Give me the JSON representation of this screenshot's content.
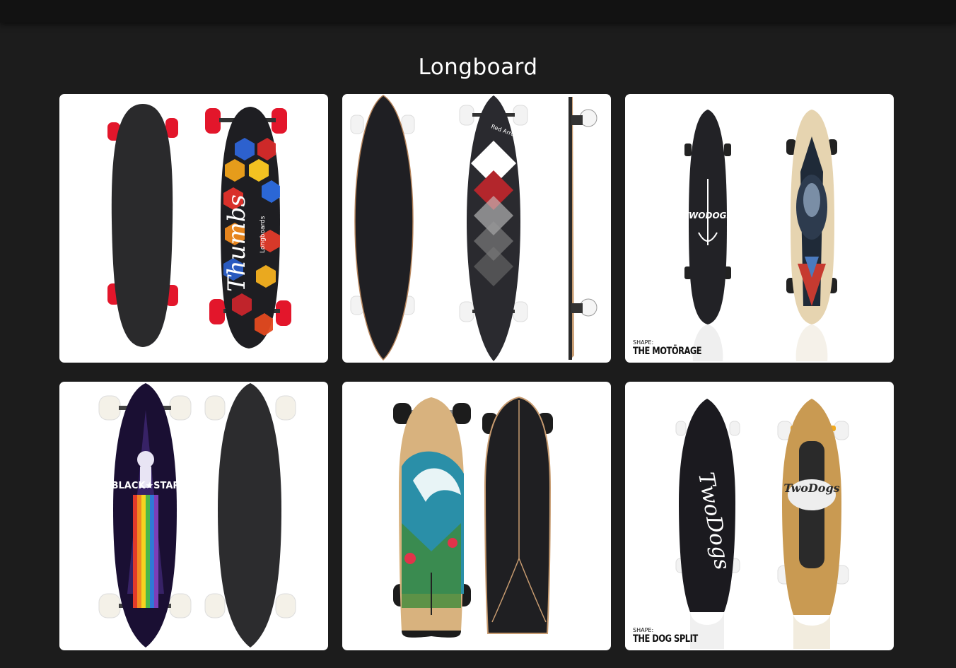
{
  "page": {
    "title": "Longboard"
  },
  "gallery": {
    "items": [
      {
        "alt": "longboard 1",
        "caption_small": "",
        "caption_name": ""
      },
      {
        "alt": "longboard 2",
        "caption_small": "",
        "caption_name": ""
      },
      {
        "alt": "longboard 3",
        "caption_small": "SHAPE:",
        "caption_name": "THE MOTÖRAGE"
      },
      {
        "alt": "longboard 4",
        "caption_small": "",
        "caption_name": ""
      },
      {
        "alt": "longboard 5",
        "caption_small": "",
        "caption_name": ""
      },
      {
        "alt": "longboard 6",
        "caption_small": "SHAPE:",
        "caption_name": "THE DOG SPLIT"
      }
    ],
    "brand_text": {
      "thumbs": "Thumbs",
      "longboards": "Longboards",
      "red_arrow": "Red Arrow",
      "two_dogs": "TWODOGS",
      "black_star": "BLACK★STAR",
      "two_dogs_script": "TwoDogs"
    }
  },
  "colors": {
    "background": "#1c1c1c",
    "topbar": "#121212",
    "card": "#ffffff",
    "wheel_red": "#e3162b",
    "deck_black": "#2a2a2c"
  }
}
